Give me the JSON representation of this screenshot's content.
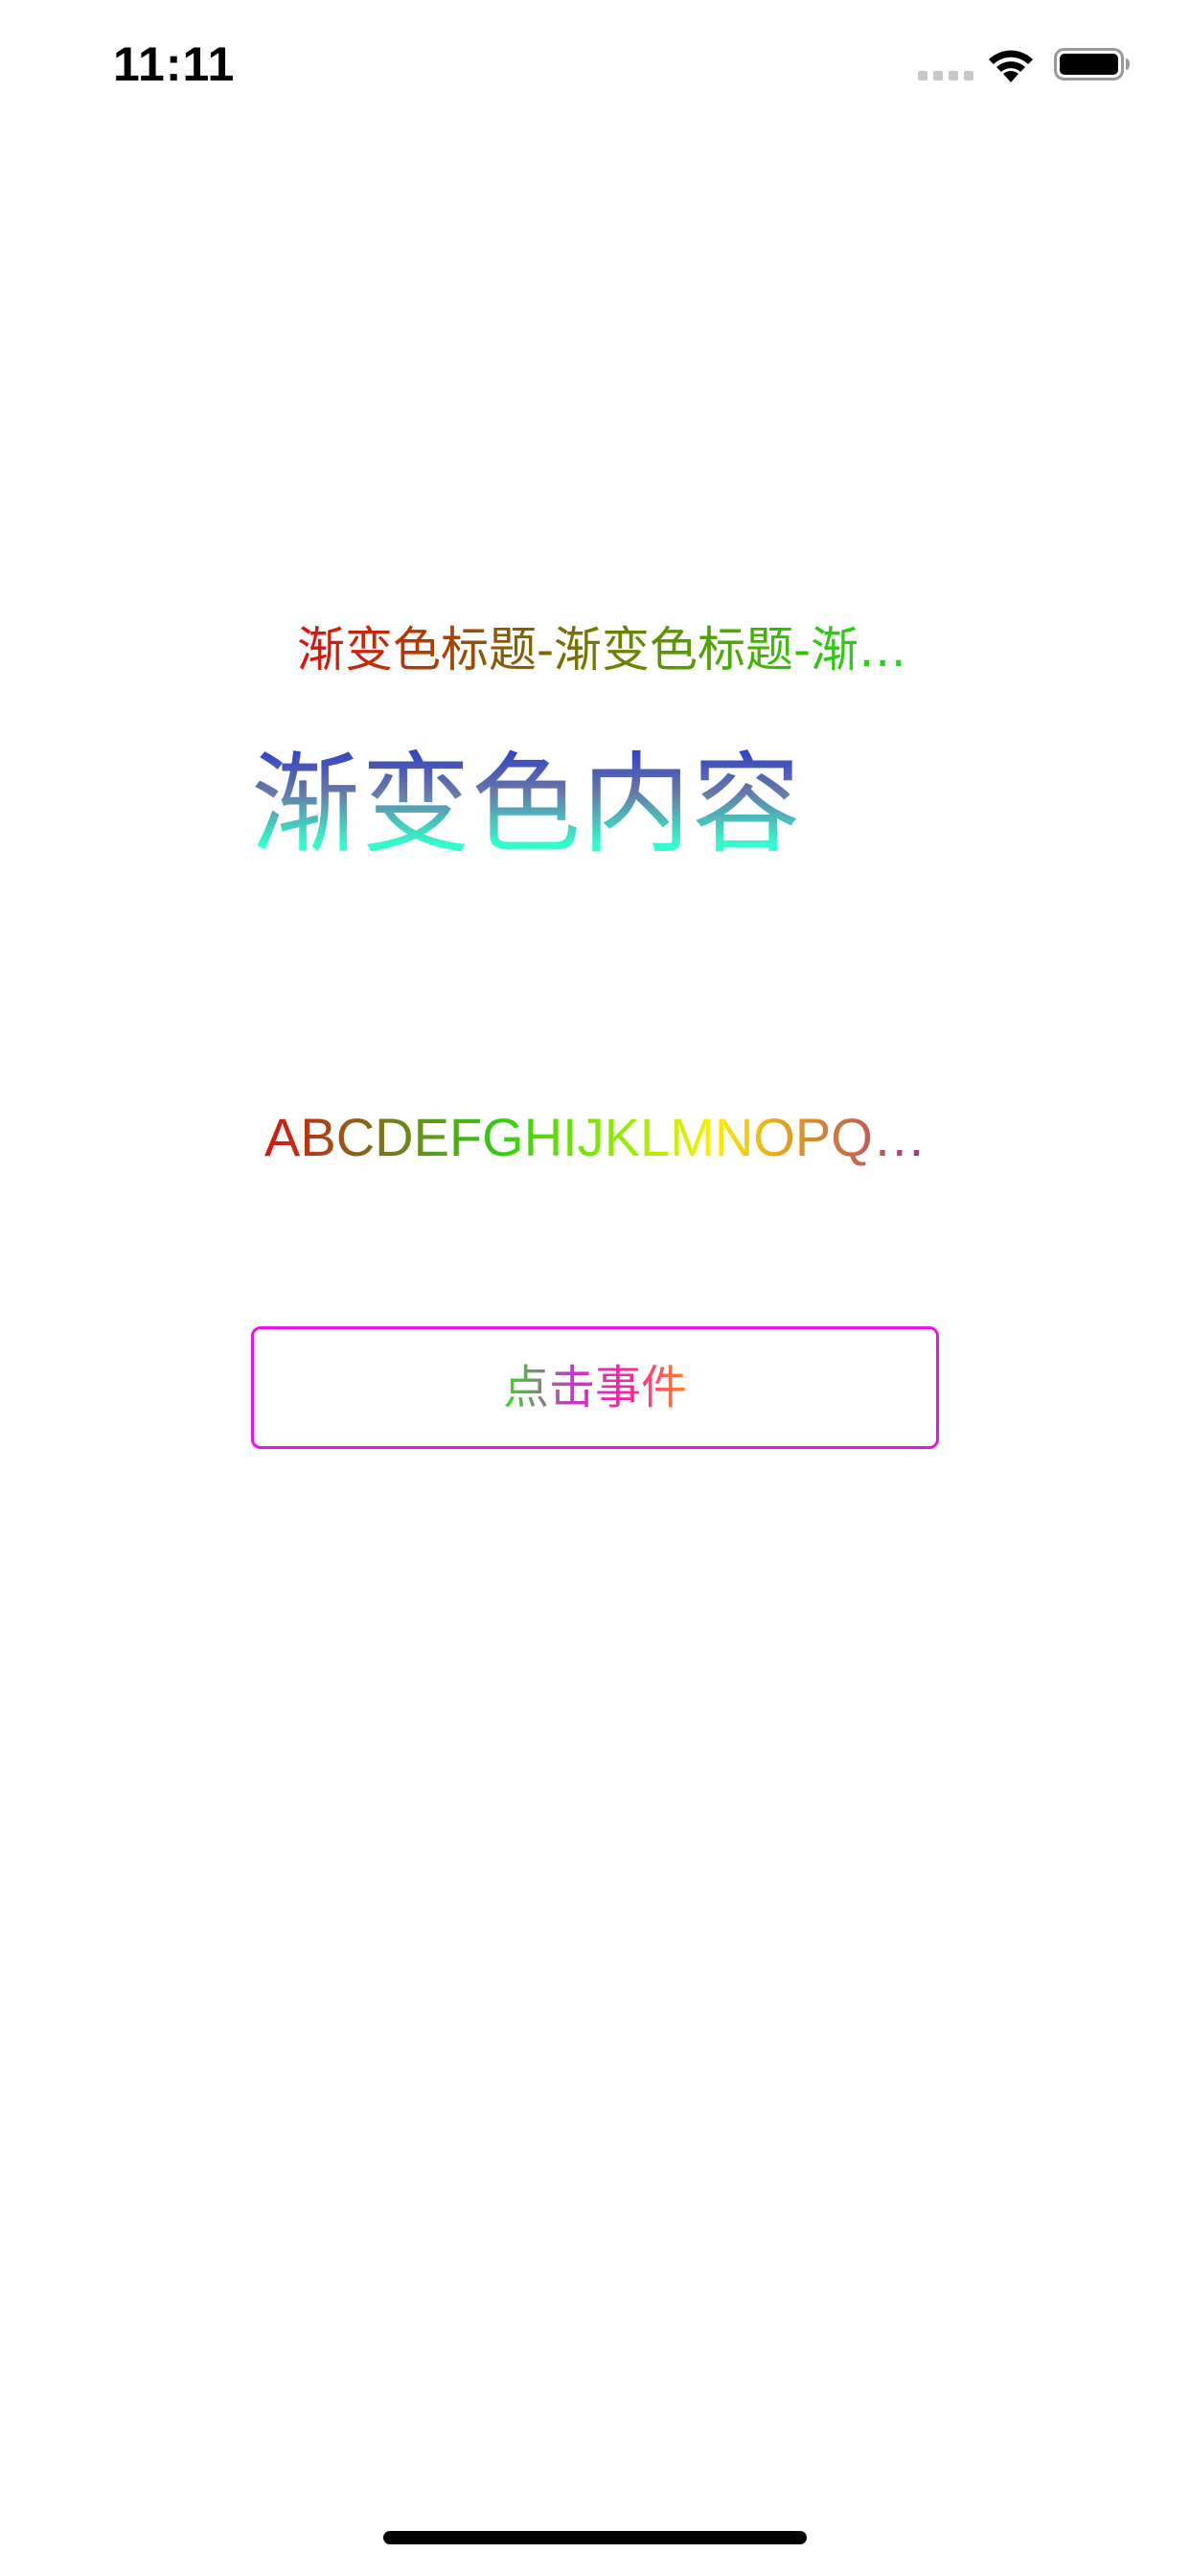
{
  "status_bar": {
    "time": "11:11",
    "icons": [
      "cellular-signal-icon",
      "wifi-icon",
      "battery-icon"
    ]
  },
  "main": {
    "gradient_title": "渐变色标题-渐变色标题-渐…",
    "gradient_content": "渐变色内容",
    "gradient_alphabet": "ABCDEFGHIJKLMNOPQ…",
    "action_button_label": "点击事件"
  },
  "colors": {
    "button_border": "#f010e0",
    "background": "#ffffff",
    "title_gradient": [
      "#e01010",
      "#8a5a00",
      "#4ca800",
      "#18e01a"
    ],
    "content_gradient": [
      "#2233cc",
      "#6677aa",
      "#33ffcc"
    ],
    "alphabet_gradient": [
      "#dd1111",
      "#88661a",
      "#33cc11",
      "#99ee00",
      "#ffee00",
      "#dd9922",
      "#aa3377"
    ],
    "button_label_gradient": [
      "#33dd22",
      "#cc33cc",
      "#ff2299",
      "#ff8822"
    ]
  }
}
